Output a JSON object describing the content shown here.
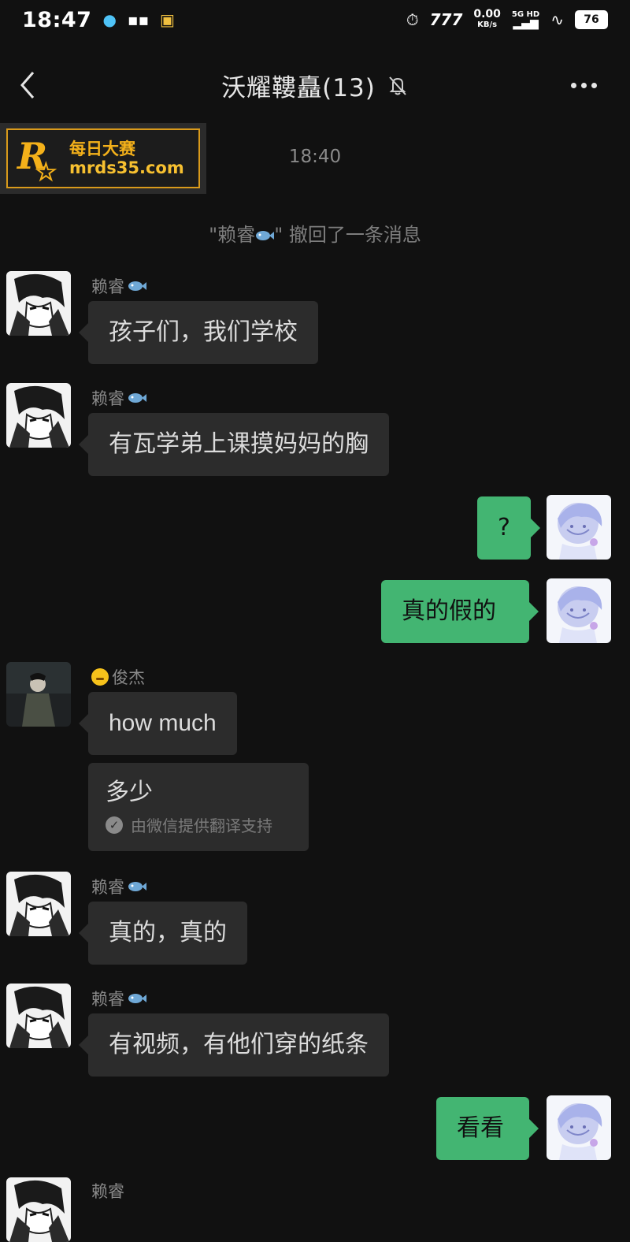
{
  "status_bar": {
    "time": "18:47",
    "net_speed_value": "0.00",
    "net_speed_unit": "KB/s",
    "signal_label_top": "5G HD",
    "battery": "76"
  },
  "header": {
    "title": "沃耀鞻矗(13)"
  },
  "watermark": {
    "logo_letter": "R",
    "logo_sub": "每日大赛",
    "site_name": "每日大赛",
    "url": "mrds35.com"
  },
  "system": {
    "time": "18:40",
    "recall_notice_prefix": "\"赖睿",
    "recall_notice_suffix": "\" 撤回了一条消息"
  },
  "messages": [
    {
      "sender": "赖睿",
      "text": "孩子们，我们学校"
    },
    {
      "sender": "赖睿",
      "text": "有瓦学弟上课摸妈妈的胸"
    },
    {
      "sender": "me",
      "text": "?"
    },
    {
      "sender": "me",
      "text": "真的假的"
    },
    {
      "sender": "俊杰",
      "text": "how much",
      "translation": "多少",
      "translation_note": "由微信提供翻译支持"
    },
    {
      "sender": "赖睿",
      "text": "真的，真的"
    },
    {
      "sender": "赖睿",
      "text": "有视频，有他们穿的纸条"
    },
    {
      "sender": "me",
      "text": "看看"
    },
    {
      "sender": "赖睿",
      "text": ""
    }
  ],
  "colors": {
    "background": "#111111",
    "incoming_bubble": "#2c2c2c",
    "outgoing_bubble": "#43b572",
    "watermark_accent": "#f4b11a"
  },
  "icons": [
    "back-icon",
    "mute-bell-icon",
    "more-icon",
    "fish-emoji-icon",
    "smile-emoji-icon",
    "check-icon"
  ]
}
